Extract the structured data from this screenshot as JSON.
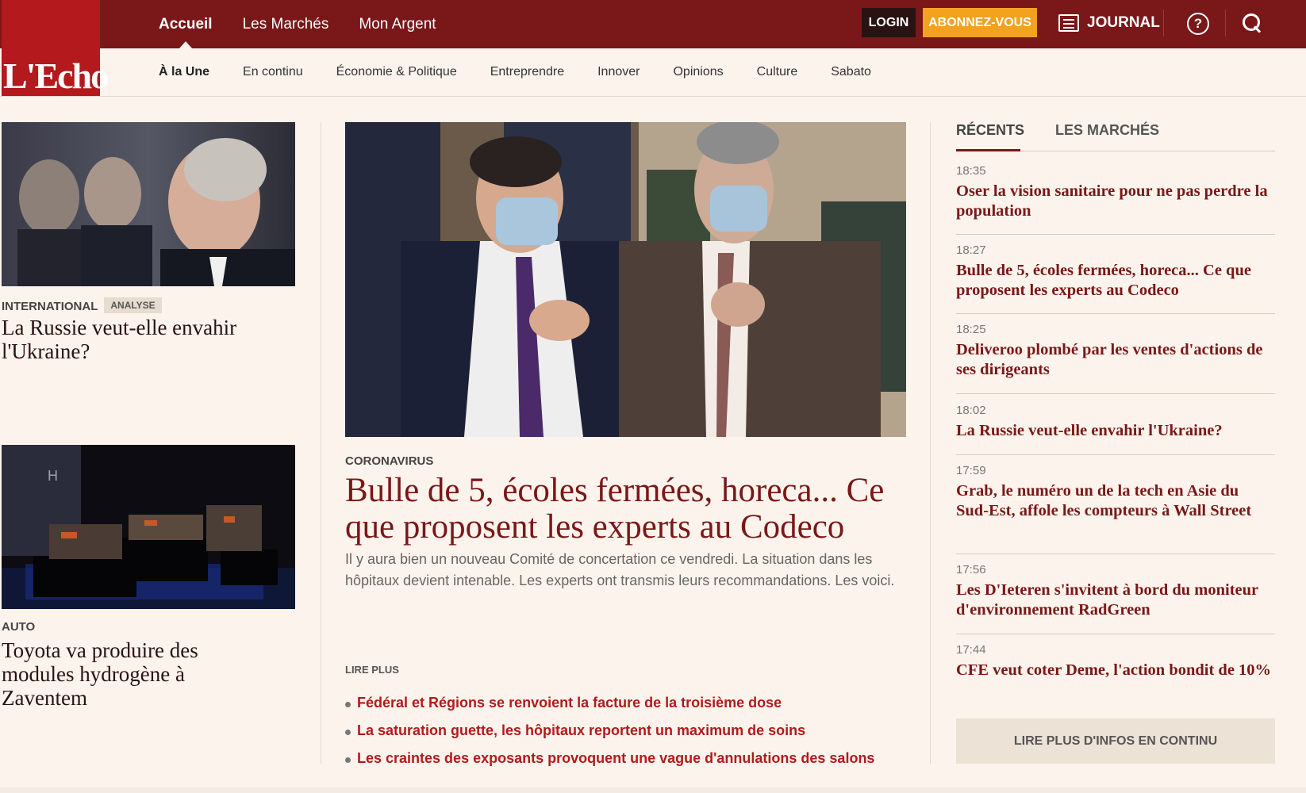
{
  "brand": {
    "logo_text": "L'Echo",
    "primary": "#7a1718",
    "accent": "#b3191d",
    "subscribe": "#f2a21f"
  },
  "main_nav": [
    "Accueil",
    "Les Marchés",
    "Mon Argent"
  ],
  "header": {
    "login": "LOGIN",
    "subscribe": "ABONNEZ-VOUS",
    "journal": "JOURNAL",
    "help": "?"
  },
  "sub_nav": [
    "À la Une",
    "En continu",
    "Économie & Politique",
    "Entreprendre",
    "Innover",
    "Opinions",
    "Culture",
    "Sabato"
  ],
  "left_articles": [
    {
      "image": "putin-photo",
      "kicker": "INTERNATIONAL",
      "badge": "ANALYSE",
      "title": "La Russie veut-elle envahir l'Ukraine?"
    },
    {
      "image": "hydrogen-modules-photo",
      "kicker": "AUTO",
      "title": "Toyota va produire des modules hydrogène à Zaventem"
    }
  ],
  "main_article": {
    "image": "ministers-masks-photo",
    "kicker": "CORONAVIRUS",
    "title": "Bulle de 5, écoles fermées, horeca... Ce que proposent les experts au Codeco",
    "lead": "Il y aura bien un nouveau Comité de concertation ce vendredi. La situation dans les hôpitaux devient intenable. Les experts ont transmis leurs recommandations. Les voici.",
    "more_label": "LIRE PLUS",
    "related": [
      "Fédéral et Régions se renvoient la facture de la troisième dose",
      "La saturation guette, les hôpitaux reportent un maximum de soins",
      "Les craintes des exposants provoquent une vague d'annulations des salons"
    ]
  },
  "sidebar": {
    "tabs": [
      "RÉCENTS",
      "LES MARCHÉS"
    ],
    "news": [
      {
        "time": "18:35",
        "title": "Oser la vision sanitaire pour ne pas perdre la population"
      },
      {
        "time": "18:27",
        "title": "Bulle de 5, écoles fermées, horeca... Ce que proposent les experts au Codeco"
      },
      {
        "time": "18:25",
        "title": "Deliveroo plombé par les ventes d'actions de ses dirigeants"
      },
      {
        "time": "18:02",
        "title": "La Russie veut-elle envahir l'Ukraine?"
      },
      {
        "time": "17:59",
        "title": "Grab, le numéro un de la tech en Asie du Sud-Est, affole les compteurs à Wall Street"
      },
      {
        "time": "17:56",
        "title": "Les D'Ieteren s'invitent à bord du moniteur d'environnement RadGreen"
      },
      {
        "time": "17:44",
        "title": "CFE veut coter Deme, l'action bondit de 10%"
      }
    ],
    "more_button": "LIRE PLUS D'INFOS EN CONTINU"
  }
}
